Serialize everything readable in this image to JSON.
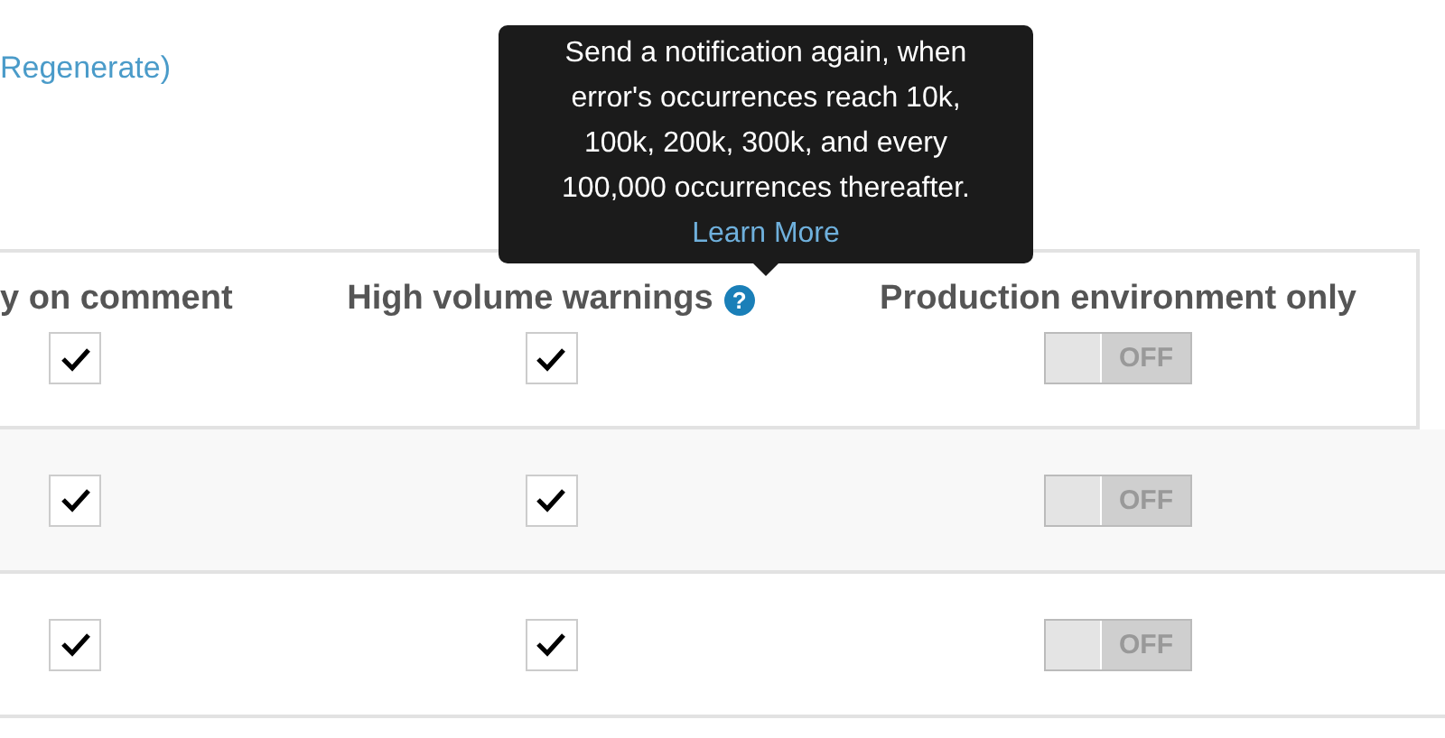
{
  "link": "Regenerate)",
  "columns": [
    {
      "label": "y on comment"
    },
    {
      "label": "High volume warnings",
      "help_icon": "?"
    },
    {
      "label": "Production environment only"
    }
  ],
  "tooltip": {
    "text": "Send a notification again, when error's occurrences reach 10k, 100k, 200k, 300k, and every 100,000 occurrences thereafter.",
    "link": "Learn More"
  },
  "rows": [
    {
      "cells": [
        {
          "kind": "checkbox",
          "checked": true
        },
        {
          "kind": "checkbox",
          "checked": true
        },
        {
          "kind": "toggle",
          "on": false,
          "label": "OFF"
        }
      ]
    },
    {
      "cells": [
        {
          "kind": "checkbox",
          "checked": true
        },
        {
          "kind": "checkbox",
          "checked": true
        },
        {
          "kind": "toggle",
          "on": false,
          "label": "OFF"
        }
      ]
    },
    {
      "cells": [
        {
          "kind": "checkbox",
          "checked": true
        },
        {
          "kind": "checkbox",
          "checked": true
        },
        {
          "kind": "toggle",
          "on": false,
          "label": "OFF"
        }
      ]
    }
  ]
}
